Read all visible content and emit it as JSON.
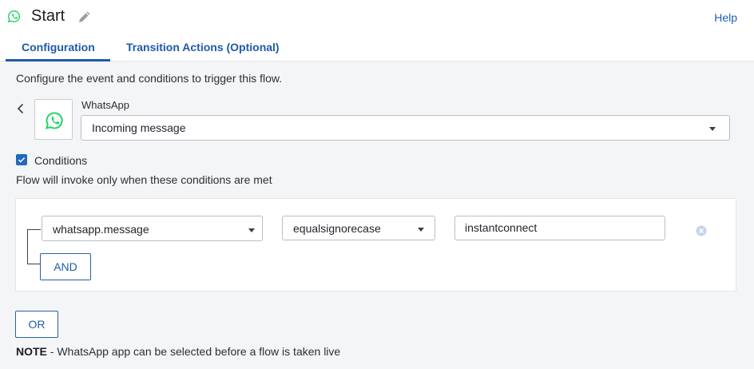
{
  "header": {
    "title": "Start",
    "help_label": "Help",
    "tabs": [
      {
        "label": "Configuration",
        "active": true
      },
      {
        "label": "Transition Actions (Optional)",
        "active": false
      }
    ]
  },
  "intro_text": "Configure the event and conditions to trigger this flow.",
  "trigger": {
    "app_label": "WhatsApp",
    "event_value": "Incoming message",
    "app_icon": "whatsapp-icon"
  },
  "conditions": {
    "checkbox_label": "Conditions",
    "checked": true,
    "description": "Flow will invoke only when these conditions are met",
    "rules": [
      {
        "field": "whatsapp.message",
        "operator": "equalsignorecase",
        "value": "instantconnect"
      }
    ],
    "and_label": "AND",
    "or_label": "OR"
  },
  "note": {
    "prefix": "NOTE",
    "text": " - WhatsApp app can be selected before a flow is taken live"
  },
  "colors": {
    "accent": "#1f5aa8",
    "whatsapp_green": "#25d366",
    "checkbox": "#2169c0"
  }
}
